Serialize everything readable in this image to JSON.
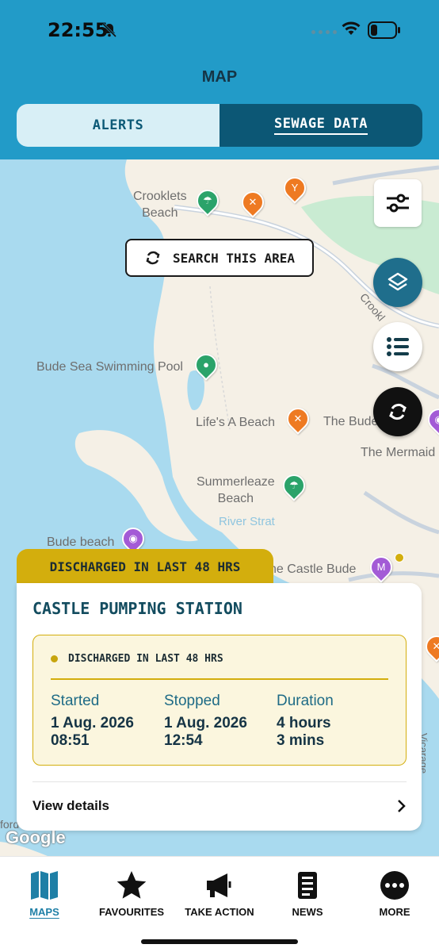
{
  "status_bar": {
    "time": "22:55"
  },
  "header": {
    "title": "MAP"
  },
  "tabs": [
    {
      "label": "ALERTS",
      "selected": false
    },
    {
      "label": "SEWAGE DATA",
      "selected": true
    }
  ],
  "map": {
    "search_button": "SEARCH THIS AREA",
    "labels": {
      "crooklets": "Crooklets\nBeach",
      "swimming_pool": "Bude Sea Swimming Pool",
      "lifes_beach": "Life's A Beach",
      "the_bude": "The Bude",
      "mermaid": "The Mermaid",
      "summerleaze": "Summerleaze\nBeach",
      "river_strat": "River Strat",
      "bude_beach": "Bude beach",
      "castle_bude": "he Castle Bude",
      "crooklets_road": "Crookl",
      "vicarage_road": "Vicarage Rd",
      "ford": "ford",
      "google": "Google"
    }
  },
  "card": {
    "tag": "DISCHARGED IN LAST 48 HRS",
    "station_name": "CASTLE PUMPING STATION",
    "status": "DISCHARGED IN LAST 48 HRS",
    "started_label": "Started",
    "started_date": "1 Aug. 2026",
    "started_time": "08:51",
    "stopped_label": "Stopped",
    "stopped_date": "1 Aug. 2026",
    "stopped_time": "12:54",
    "duration_label": "Duration",
    "duration_hours": "4 hours",
    "duration_mins": "3 mins",
    "view_details": "View details"
  },
  "bottom_nav": [
    {
      "label": "MAPS",
      "icon": "map-icon",
      "selected": true
    },
    {
      "label": "FAVOURITES",
      "icon": "star-icon",
      "selected": false
    },
    {
      "label": "TAKE ACTION",
      "icon": "megaphone-icon",
      "selected": false
    },
    {
      "label": "NEWS",
      "icon": "news-icon",
      "selected": false
    },
    {
      "label": "MORE",
      "icon": "more-icon",
      "selected": false
    }
  ],
  "colors": {
    "header_bg": "#229BC8",
    "selected_tab": "#0C5775",
    "alert_yellow": "#D3AE0D",
    "sea": "#A9DAEF",
    "land": "#F5F0E6",
    "park": "#C9EBD2"
  }
}
